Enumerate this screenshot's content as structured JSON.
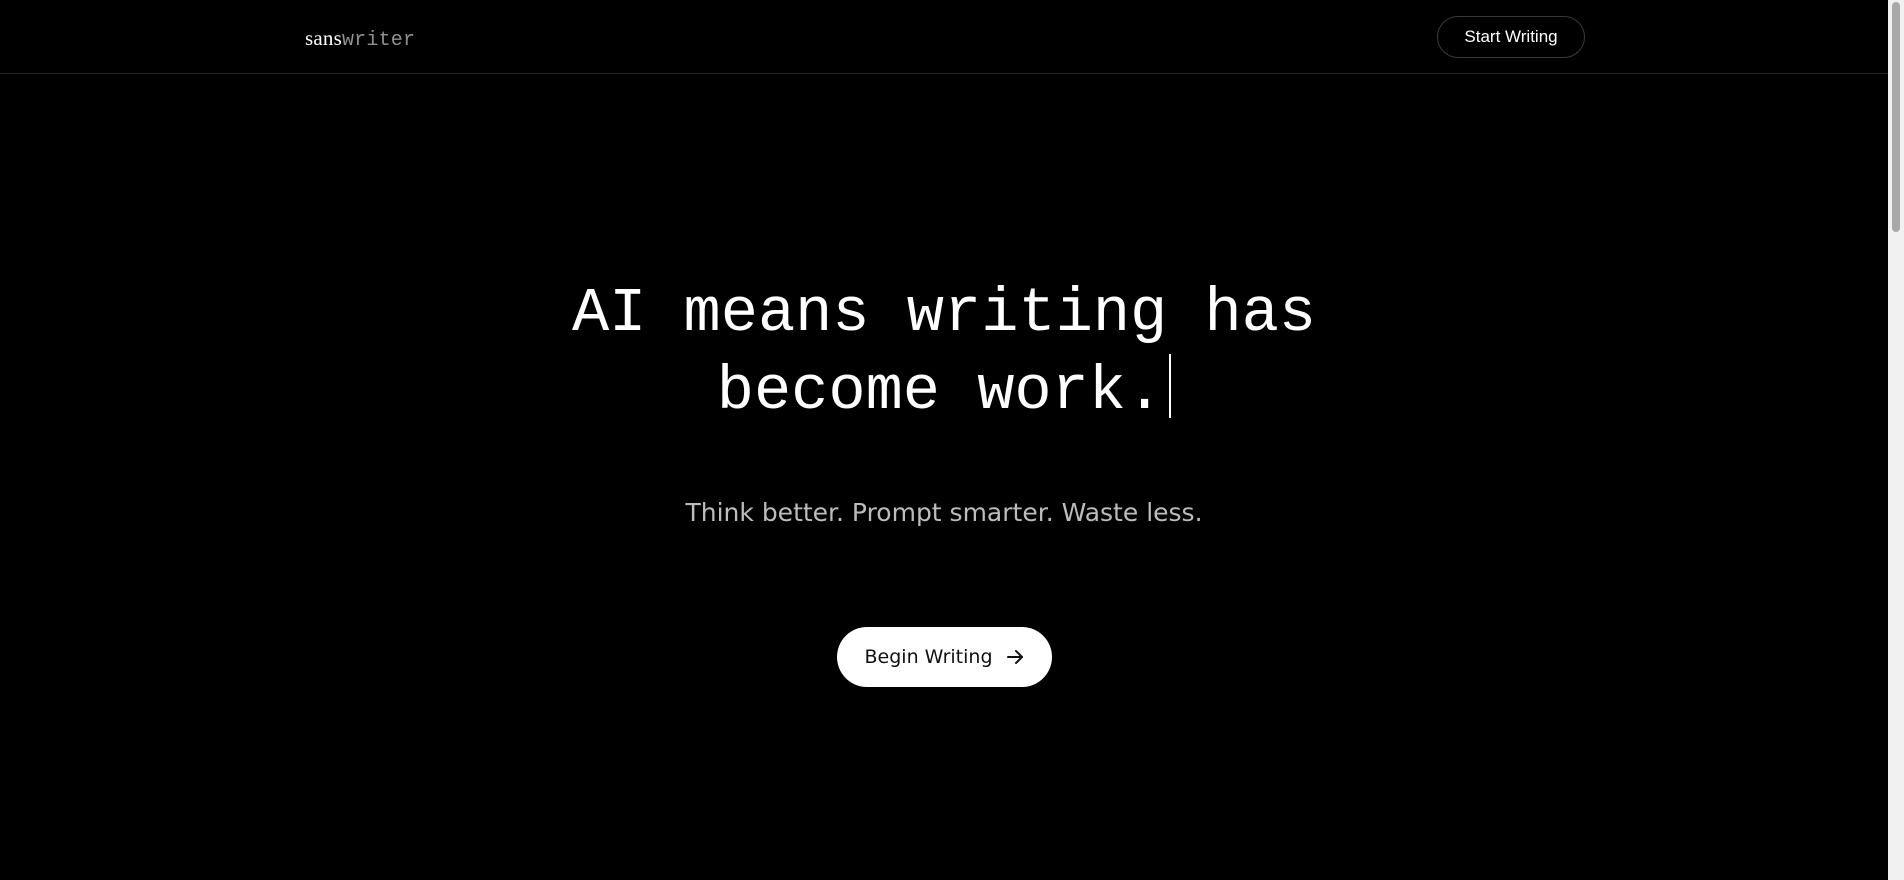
{
  "header": {
    "logo_part1": "sans",
    "logo_part2": "writer",
    "start_button_label": "Start Writing"
  },
  "hero": {
    "headline_line1": "AI means writing has",
    "headline_line2": "become work.",
    "tagline": "Think better. Prompt smarter. Waste less.",
    "cta_label": "Begin Writing",
    "cta_icon": "arrow-right-icon"
  },
  "colors": {
    "background": "#000000",
    "text": "#ffffff",
    "muted": "#8f8f8f",
    "tagline": "#bcbcbc",
    "cta_background": "#ffffff"
  }
}
